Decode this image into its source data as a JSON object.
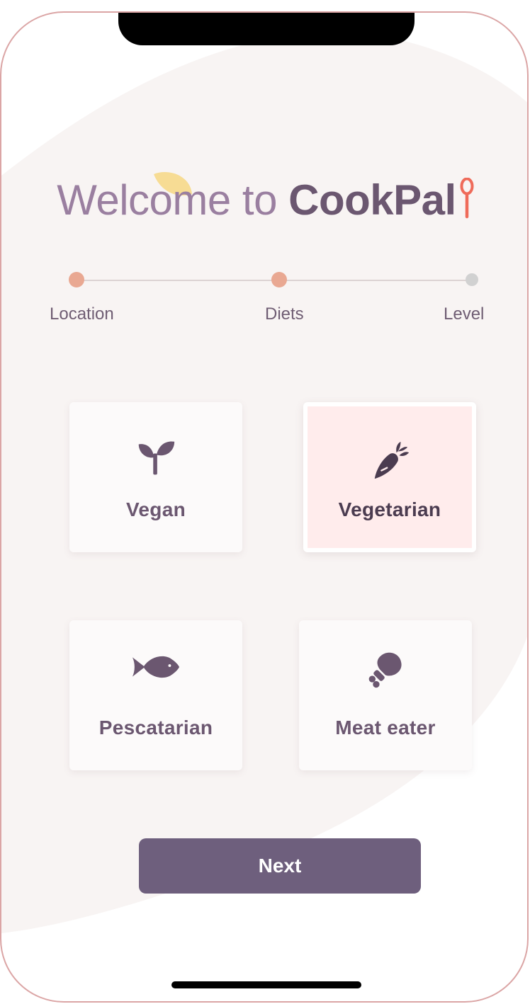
{
  "header": {
    "title_prefix": "Welcome to",
    "title_brand": "CookPal"
  },
  "stepper": {
    "steps": [
      {
        "label": "Location",
        "state": "complete"
      },
      {
        "label": "Diets",
        "state": "current"
      },
      {
        "label": "Level",
        "state": "upcoming"
      }
    ]
  },
  "diets": {
    "options": [
      {
        "label": "Vegan",
        "icon": "sprout-icon",
        "selected": false
      },
      {
        "label": "Vegetarian",
        "icon": "carrot-icon",
        "selected": true
      },
      {
        "label": "Pescatarian",
        "icon": "fish-icon",
        "selected": false
      },
      {
        "label": "Meat eater",
        "icon": "drumstick-icon",
        "selected": false
      }
    ]
  },
  "actions": {
    "next_label": "Next"
  },
  "colors": {
    "accent_purple": "#6e5f7d",
    "title_light": "#9a7fa0",
    "step_active": "#e9a892",
    "step_inactive": "#d1d1d1",
    "selected_card_bg": "#ffecec",
    "spoon": "#ef6b5a",
    "leaf": "#f6d98a",
    "frame_border": "#dba5a5"
  }
}
